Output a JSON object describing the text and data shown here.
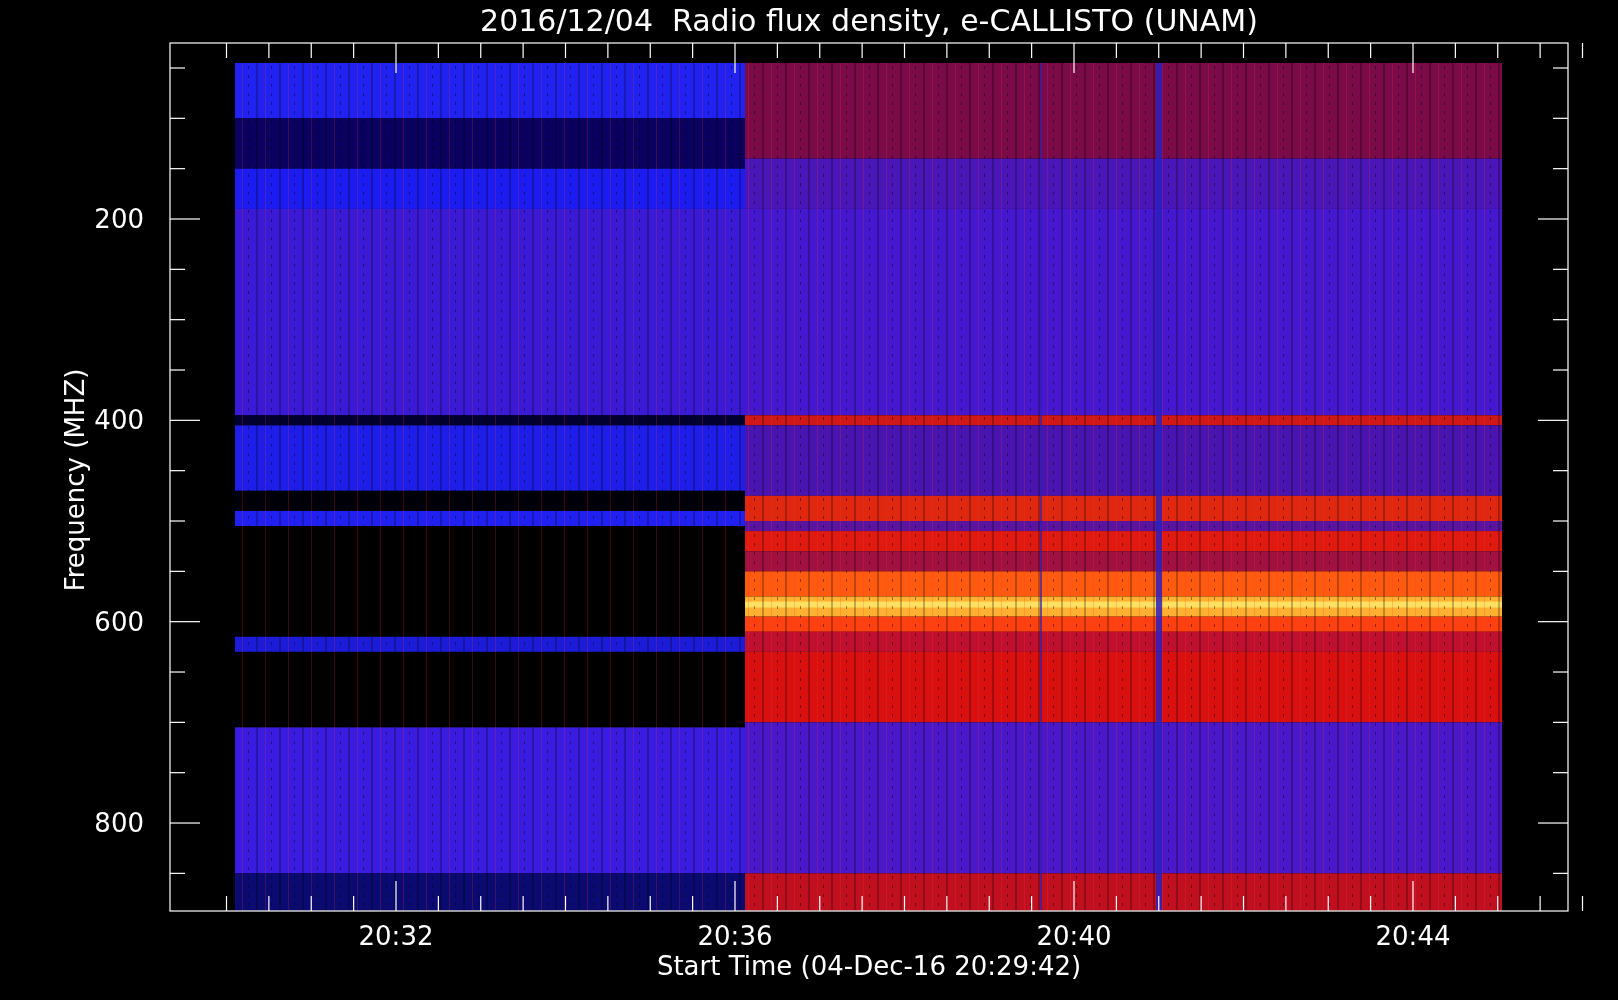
{
  "title": "2016/12/04  Radio flux density, e-CALLISTO (UNAM)",
  "y_axis": {
    "label": "Frequency (MHZ)",
    "ticks": [
      "200",
      "400",
      "600",
      "800"
    ]
  },
  "x_axis": {
    "label": "Start Time (04-Dec-16 20:29:42)",
    "ticks": [
      "20:32",
      "20:36",
      "20:40",
      "20:44"
    ]
  }
}
